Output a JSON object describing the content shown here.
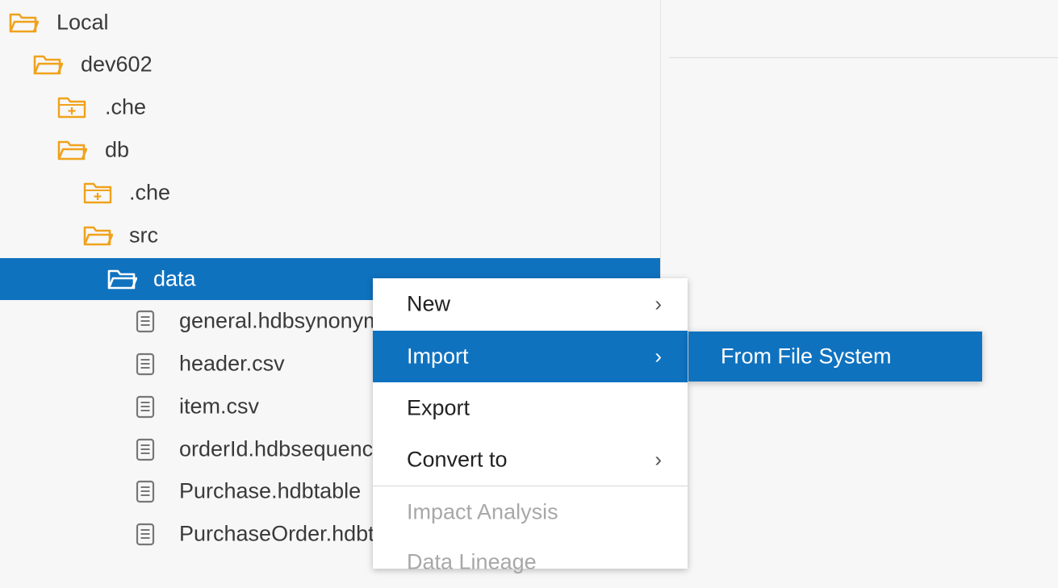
{
  "tree": {
    "items": [
      {
        "label": "Local",
        "icon": "folder-open-icon"
      },
      {
        "label": "dev602",
        "icon": "folder-open-icon"
      },
      {
        "label": ".che",
        "icon": "folder-plus-icon"
      },
      {
        "label": "db",
        "icon": "folder-open-icon"
      },
      {
        "label": ".che",
        "icon": "folder-plus-icon"
      },
      {
        "label": "src",
        "icon": "folder-open-icon"
      },
      {
        "label": "data",
        "icon": "folder-open-icon",
        "selected": true
      },
      {
        "label": "general.hdbsynonym",
        "icon": "file-icon"
      },
      {
        "label": "header.csv",
        "icon": "file-icon"
      },
      {
        "label": "item.csv",
        "icon": "file-icon"
      },
      {
        "label": "orderId.hdbsequence",
        "icon": "file-icon"
      },
      {
        "label": "Purchase.hdbtable",
        "icon": "file-icon"
      },
      {
        "label": "PurchaseOrder.hdbtable",
        "icon": "file-icon"
      }
    ]
  },
  "context_menu": {
    "items": [
      {
        "label": "New",
        "submenu_arrow": "›"
      },
      {
        "label": "Import",
        "submenu_arrow": "›",
        "active": true
      },
      {
        "label": "Export"
      },
      {
        "label": "Convert to",
        "submenu_arrow": "›"
      },
      {
        "label": "Impact Analysis",
        "disabled": true
      },
      {
        "label": "Data Lineage",
        "disabled": true
      }
    ]
  },
  "submenu": {
    "items": [
      {
        "label": "From File System"
      }
    ]
  },
  "colors": {
    "selection": "#0f72bf",
    "folder": "#f0a21b",
    "file_icon": "#777777"
  }
}
